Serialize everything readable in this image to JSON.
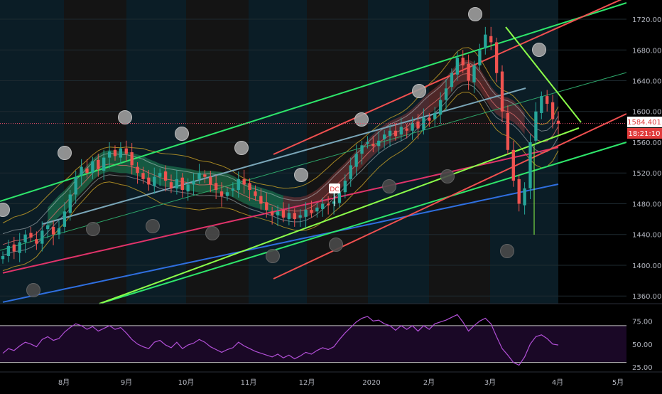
{
  "chart_data": {
    "type": "candlestick",
    "title": "",
    "main_price_axis": {
      "ticks": [
        "1720.000",
        "1680.000",
        "1640.000",
        "1600.000",
        "1560.000",
        "1520.000",
        "1480.000",
        "1440.000",
        "1400.000",
        "1360.000"
      ],
      "ylim": [
        1350,
        1745
      ]
    },
    "time_axis": {
      "ticks": [
        "8月",
        "9月",
        "10月",
        "11月",
        "12月",
        "2020",
        "2月",
        "3月",
        "4月",
        "5月"
      ]
    },
    "current_price_label": "1584.401",
    "countdown_label": "18:21:10",
    "event_marker": "DC",
    "close_series_approx": [
      1412,
      1425,
      1418,
      1430,
      1440,
      1436,
      1428,
      1445,
      1452,
      1440,
      1448,
      1470,
      1492,
      1515,
      1528,
      1520,
      1535,
      1525,
      1540,
      1548,
      1542,
      1552,
      1545,
      1530,
      1520,
      1512,
      1505,
      1515,
      1520,
      1510,
      1500,
      1512,
      1498,
      1505,
      1510,
      1520,
      1515,
      1505,
      1498,
      1490,
      1495,
      1500,
      1512,
      1505,
      1498,
      1490,
      1480,
      1472,
      1465,
      1470,
      1462,
      1468,
      1460,
      1465,
      1472,
      1468,
      1475,
      1480,
      1478,
      1483,
      1495,
      1510,
      1530,
      1545,
      1556,
      1560,
      1555,
      1562,
      1570,
      1575,
      1568,
      1580,
      1575,
      1585,
      1578,
      1592,
      1588,
      1598,
      1615,
      1630,
      1650,
      1670,
      1660,
      1640,
      1660,
      1680,
      1700,
      1690,
      1650,
      1600,
      1550,
      1510,
      1480,
      1500,
      1560,
      1600,
      1620,
      1610,
      1590,
      1584
    ],
    "rsi_panel": {
      "ticks": [
        "75.00",
        "50.00",
        "25.00"
      ],
      "ylim": [
        22,
        90
      ],
      "upper_band": 70,
      "lower_band": 30,
      "values_approx": [
        40,
        45,
        43,
        48,
        52,
        50,
        47,
        55,
        58,
        54,
        56,
        63,
        68,
        72,
        70,
        66,
        69,
        64,
        67,
        70,
        66,
        68,
        62,
        55,
        50,
        47,
        45,
        52,
        54,
        49,
        46,
        52,
        45,
        49,
        51,
        55,
        52,
        47,
        44,
        41,
        44,
        46,
        52,
        48,
        45,
        42,
        40,
        38,
        36,
        39,
        35,
        38,
        34,
        37,
        41,
        39,
        43,
        46,
        44,
        47,
        55,
        62,
        68,
        74,
        78,
        80,
        75,
        76,
        72,
        70,
        65,
        70,
        66,
        70,
        64,
        70,
        66,
        72,
        74,
        76,
        79,
        82,
        74,
        64,
        70,
        75,
        78,
        72,
        58,
        45,
        38,
        30,
        27,
        36,
        50,
        58,
        60,
        56,
        50,
        49
      ]
    }
  }
}
